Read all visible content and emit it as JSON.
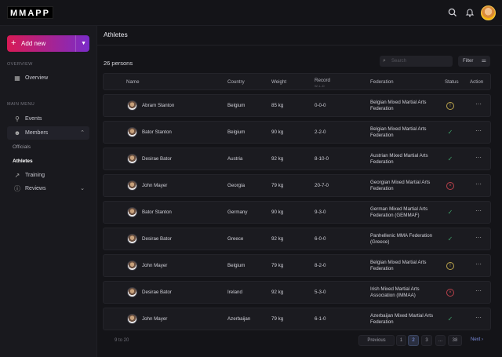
{
  "brand": {
    "logo_text": "MMAPP",
    "logo_accent": "#e3226b"
  },
  "topbar": {
    "search_icon": "search-icon",
    "bell_icon": "bell-icon",
    "avatar": "user-avatar"
  },
  "sidebar": {
    "add_new_label": "Add new",
    "overview_section": "OVERVIEW",
    "overview_item": "Overview",
    "main_menu_section": "MAIN MENU",
    "items": [
      {
        "label": "Events",
        "icon": "events-icon"
      },
      {
        "label": "Members",
        "icon": "members-icon"
      },
      {
        "label": "Training",
        "icon": "training-icon"
      },
      {
        "label": "Reviews",
        "icon": "reviews-icon"
      }
    ],
    "sub_items": [
      {
        "label": "Officials"
      },
      {
        "label": "Athletes"
      }
    ]
  },
  "main": {
    "title": "Athletes",
    "count_text": "26 persons",
    "search_placeholder": "Search",
    "filter_label": "Filter"
  },
  "table": {
    "headers": {
      "name": "Name",
      "country": "Country",
      "weight": "Weight",
      "record": "Record",
      "record_sub": "W-L-D",
      "federation": "Federation",
      "status": "Status",
      "action": "Action"
    },
    "rows": [
      {
        "name": "Abram Stanton",
        "country": "Belgium",
        "weight": "85 kg",
        "record": "0-0-0",
        "federation": "Belgian Mixed Martial Arts Federation",
        "status": "warning",
        "status_glyph": "!"
      },
      {
        "name": "Bator Stanton",
        "country": "Belgium",
        "weight": "90 kg",
        "record": "2-2-0",
        "federation": "Belgian Mixed Martial Arts Federation",
        "status": "ok",
        "status_glyph": "✓"
      },
      {
        "name": "Desirae Bator",
        "country": "Austria",
        "weight": "92 kg",
        "record": "8-10-0",
        "federation": "Austrian Mixed Martial Arts Federation",
        "status": "ok",
        "status_glyph": "✓"
      },
      {
        "name": "John Mayer",
        "country": "Georgia",
        "weight": "79 kg",
        "record": "20-7-0",
        "federation": "Georgian Mixed Martial Arts Federation",
        "status": "error",
        "status_glyph": "×"
      },
      {
        "name": "Bator Stanton",
        "country": "Germany",
        "weight": "90 kg",
        "record": "9-3-0",
        "federation": "German Mixed Martial Arts Federation (GEMMAF)",
        "status": "ok",
        "status_glyph": "✓"
      },
      {
        "name": "Desirae Bator",
        "country": "Greece",
        "weight": "92 kg",
        "record": "6-0-0",
        "federation": "Panhellenic MMA Federation (Greece)",
        "status": "ok",
        "status_glyph": "✓"
      },
      {
        "name": "John Mayer",
        "country": "Belgium",
        "weight": "79 kg",
        "record": "8-2-0",
        "federation": "Belgian Mixed Martial Arts Federation",
        "status": "warning",
        "status_glyph": "!"
      },
      {
        "name": "Desirae Bator",
        "country": "Ireland",
        "weight": "92 kg",
        "record": "5-3-0",
        "federation": "Irish Mixed Martial Arts Association (IMMAA)",
        "status": "error",
        "status_glyph": "×"
      },
      {
        "name": "John Mayer",
        "country": "Azerbaijan",
        "weight": "79 kg",
        "record": "6-1-0",
        "federation": "Azerbaijan Mixed Martial Arts Federation",
        "status": "ok",
        "status_glyph": "✓"
      }
    ]
  },
  "pagination": {
    "range": "9 to 20",
    "previous": "Previous",
    "next": "Next",
    "pages": [
      "1",
      "2",
      "3",
      "...",
      "38"
    ],
    "current": "2"
  },
  "colors": {
    "accent": "#7d8fe0",
    "ok": "#3fa46a",
    "warning": "#c8b050",
    "error": "#c84650"
  }
}
